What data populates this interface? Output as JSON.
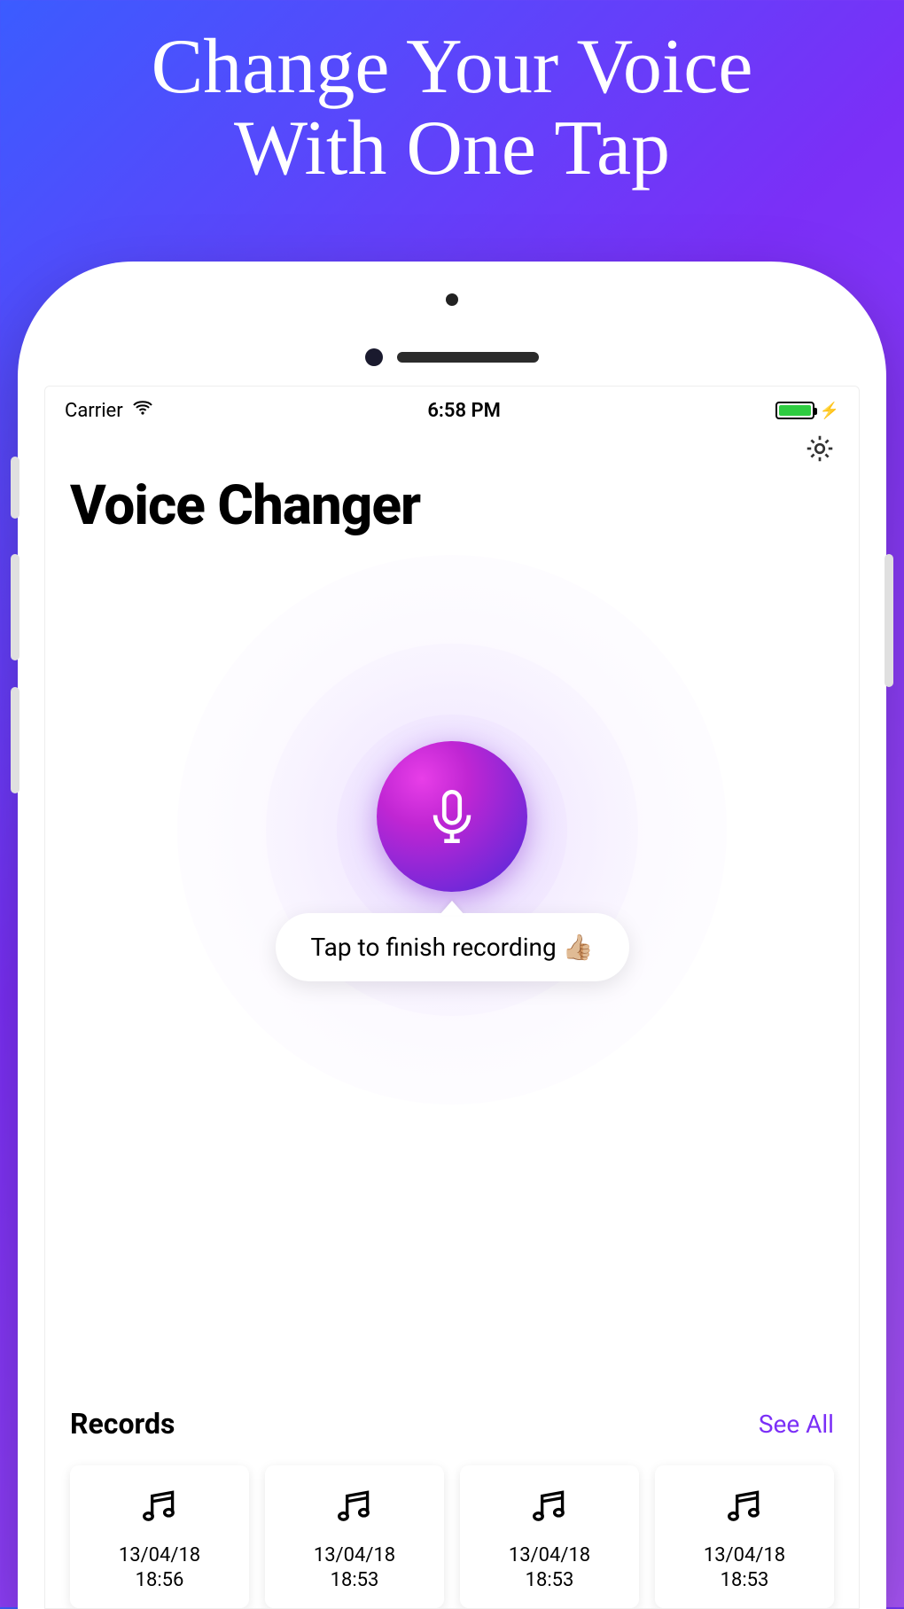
{
  "promo": {
    "line1": "Change Your Voice",
    "line2": "With One Tap"
  },
  "status": {
    "carrier": "Carrier",
    "time": "6:58 PM"
  },
  "screen": {
    "title": "Voice Changer",
    "tooltip": "Tap to finish recording 👍🏼"
  },
  "records": {
    "title": "Records",
    "see_all": "See All",
    "items": [
      {
        "date": "13/04/18",
        "time": "18:56"
      },
      {
        "date": "13/04/18",
        "time": "18:53"
      },
      {
        "date": "13/04/18",
        "time": "18:53"
      },
      {
        "date": "13/04/18",
        "time": "18:53"
      }
    ]
  }
}
